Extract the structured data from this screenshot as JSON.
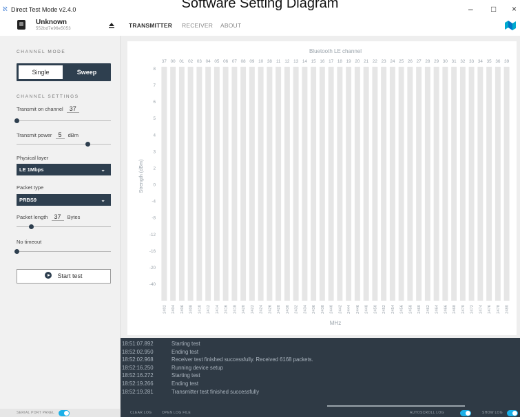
{
  "caption": "Software Setting Diagram",
  "window": {
    "title": "Direct Test Mode v2.4.0",
    "minimize": "–",
    "maximize": "□",
    "close": "×"
  },
  "header": {
    "device_name": "Unknown",
    "device_serial": "552bd7e96e5053",
    "tabs": [
      "TRANSMITTER",
      "RECEIVER",
      "ABOUT"
    ],
    "active_tab": "TRANSMITTER"
  },
  "sidebar": {
    "channel_mode_title": "CHANNEL MODE",
    "mode_single": "Single",
    "mode_sweep": "Sweep",
    "channel_settings_title": "CHANNEL SETTINGS",
    "transmit_channel_label": "Transmit on channel",
    "transmit_channel_value": "37",
    "transmit_channel_level": 1.0,
    "transmit_power_label": "Transmit power",
    "transmit_power_value": "5",
    "transmit_power_unit": "dBm",
    "transmit_power_level": 0.75,
    "physical_layer_label": "Physical layer",
    "physical_layer_value": "LE 1Mbps",
    "packet_type_label": "Packet type",
    "packet_type_value": "PRBS9",
    "packet_length_label": "Packet length",
    "packet_length_value": "37",
    "packet_length_unit": "Bytes",
    "packet_length_level": 0.15,
    "timeout_label": "No timeout",
    "timeout_level": 0.0,
    "start_button": "Start test"
  },
  "chart_data": {
    "type": "bar",
    "title": "Bluetooth LE channel",
    "xlabel": "MHz",
    "ylabel": "Strength (dBm)",
    "channels": [
      "37",
      "00",
      "01",
      "02",
      "03",
      "04",
      "05",
      "06",
      "07",
      "08",
      "09",
      "10",
      "38",
      "11",
      "12",
      "13",
      "14",
      "15",
      "16",
      "17",
      "18",
      "19",
      "20",
      "21",
      "22",
      "23",
      "24",
      "25",
      "26",
      "27",
      "28",
      "29",
      "30",
      "31",
      "32",
      "33",
      "34",
      "35",
      "36",
      "39"
    ],
    "frequencies": [
      "2402",
      "2404",
      "2406",
      "2408",
      "2410",
      "2412",
      "2414",
      "2416",
      "2418",
      "2420",
      "2422",
      "2424",
      "2426",
      "2428",
      "2430",
      "2432",
      "2434",
      "2436",
      "2438",
      "2440",
      "2442",
      "2444",
      "2446",
      "2448",
      "2450",
      "2452",
      "2454",
      "2456",
      "2458",
      "2460",
      "2462",
      "2464",
      "2466",
      "2468",
      "2470",
      "2472",
      "2474",
      "2476",
      "2478",
      "2480"
    ],
    "y_ticks": [
      "8",
      "7",
      "6",
      "5",
      "4",
      "3",
      "2",
      "0",
      "-4",
      "-8",
      "-12",
      "-16",
      "-20",
      "-40"
    ],
    "values": [],
    "bar_color": "#e6e6e6"
  },
  "log": [
    {
      "time": "18:51:07.892",
      "msg": "Starting test"
    },
    {
      "time": "18:52:02.950",
      "msg": "Ending test"
    },
    {
      "time": "18:52:02.968",
      "msg": "Receiver test finished successfully. Received 6168 packets."
    },
    {
      "time": "18:52:16.250",
      "msg": "Running device setup"
    },
    {
      "time": "18:52:16.272",
      "msg": "Starting test"
    },
    {
      "time": "18:52:19.266",
      "msg": "Ending test"
    },
    {
      "time": "18:52:19.281",
      "msg": "Transmitter test finished successfully"
    }
  ],
  "footer": {
    "serial_port_label": "SERIAL PORT PANEL",
    "clear_log": "CLEAR LOG",
    "open_log_file": "OPEN LOG FILE",
    "autoscroll_label": "AUTOSCROLL LOG",
    "show_log_label": "SHOW LOG"
  },
  "colors": {
    "accent": "#2e3f4f",
    "toggle_on": "#1ab0e8",
    "log_bg": "#2f3a45"
  }
}
